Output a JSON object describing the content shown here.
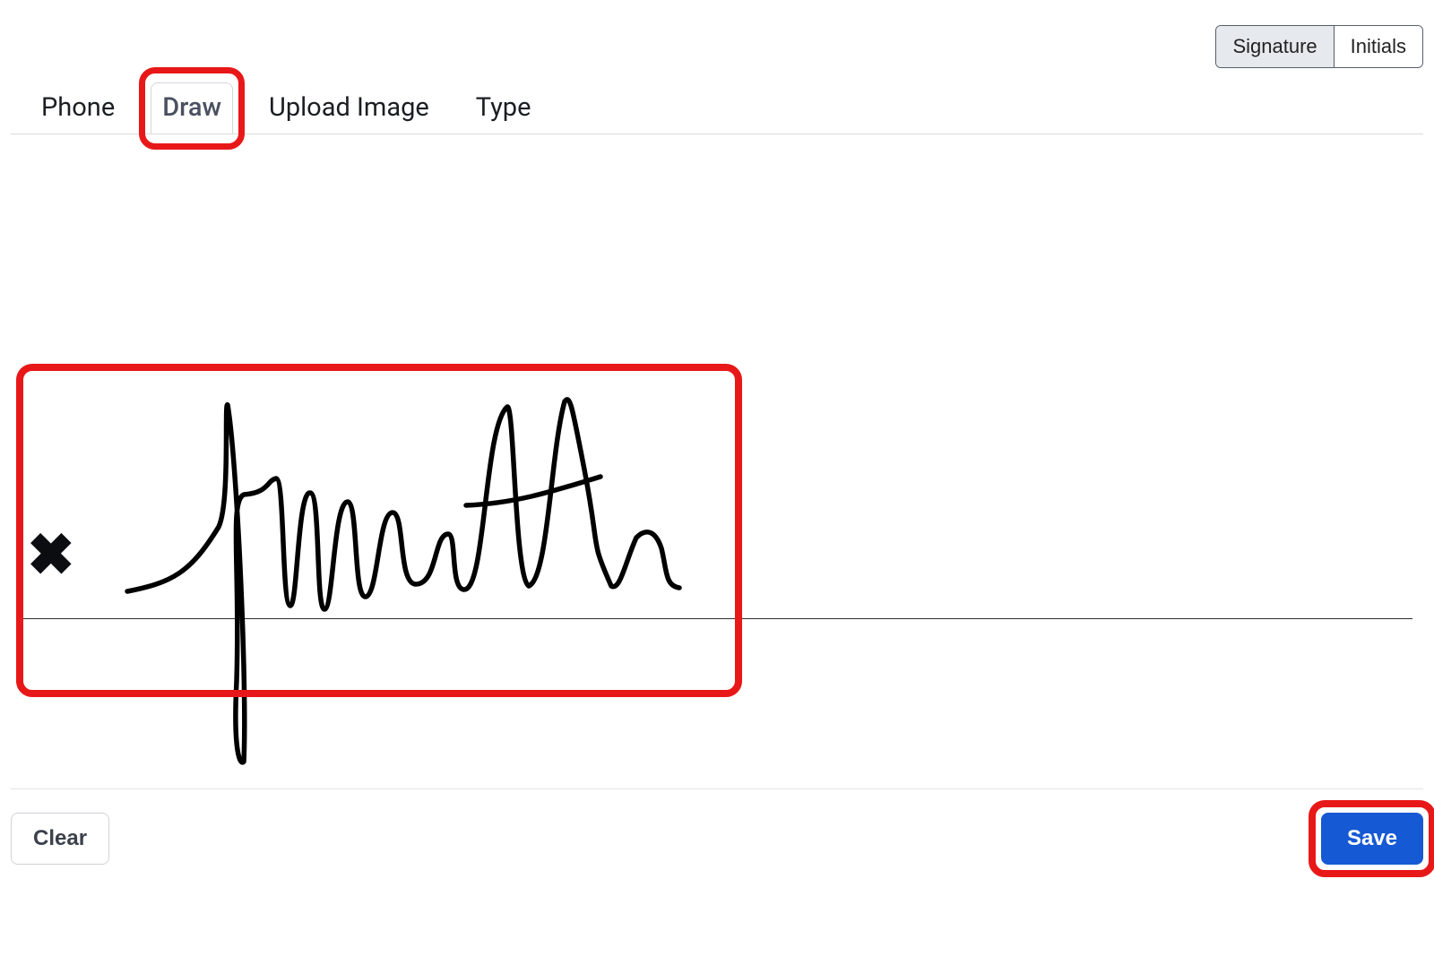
{
  "mode_toggle": {
    "signature": "Signature",
    "initials": "Initials",
    "selected": "Signature"
  },
  "tabs": {
    "phone": "Phone",
    "draw": "Draw",
    "upload": "Upload Image",
    "type": "Type",
    "active": "Draw"
  },
  "signature": {
    "has_drawing": true,
    "description": "Hand-drawn cursive signature on canvas"
  },
  "buttons": {
    "clear": "Clear",
    "save": "Save"
  },
  "annotations": {
    "highlight_tab": "Draw",
    "highlight_canvas": true,
    "highlight_save": true
  }
}
